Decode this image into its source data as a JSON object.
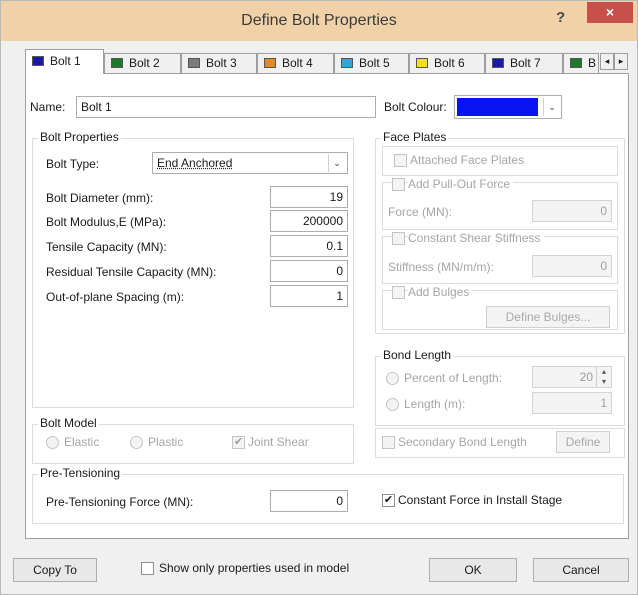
{
  "window": {
    "title": "Define Bolt Properties",
    "help": "?",
    "close": "×"
  },
  "tabs": [
    {
      "label": "Bolt 1",
      "color": "#1a1aa8"
    },
    {
      "label": "Bolt 2",
      "color": "#1e7a2a"
    },
    {
      "label": "Bolt 3",
      "color": "#7a7a7a"
    },
    {
      "label": "Bolt 4",
      "color": "#e08a2a"
    },
    {
      "label": "Bolt 5",
      "color": "#2aa8d8"
    },
    {
      "label": "Bolt 6",
      "color": "#f0e020"
    },
    {
      "label": "Bolt 7",
      "color": "#1a1aa8"
    },
    {
      "label": "B",
      "color": "#1e7a2a"
    }
  ],
  "tab_scroll": {
    "left": "◂",
    "right": "▸"
  },
  "name": {
    "label": "Name:",
    "value": "Bolt 1"
  },
  "bolt_colour": {
    "label": "Bolt Colour:",
    "value": "#0a14f0",
    "arrow": "⌄"
  },
  "bolt_properties": {
    "title": "Bolt Properties",
    "type_label": "Bolt Type:",
    "type_value": "End Anchored",
    "type_arrow": "⌄",
    "diameter_label": "Bolt Diameter (mm):",
    "diameter_value": "19",
    "modulus_label": "Bolt Modulus,E (MPa):",
    "modulus_value": "200000",
    "tensile_label": "Tensile Capacity (MN):",
    "tensile_value": "0.1",
    "residual_label": "Residual Tensile Capacity (MN):",
    "residual_value": "0",
    "spacing_label": "Out-of-plane Spacing (m):",
    "spacing_value": "1"
  },
  "face_plates": {
    "title": "Face Plates",
    "attached_label": "Attached Face Plates",
    "pullout_label": "Add Pull-Out Force",
    "force_label": "Force (MN):",
    "force_value": "0",
    "shear_label": "Constant Shear Stiffness",
    "stiffness_label": "Stiffness (MN/m/m):",
    "stiffness_value": "0",
    "bulges_label": "Add Bulges",
    "define_bulges": "Define Bulges..."
  },
  "bond_length": {
    "title": "Bond Length",
    "percent_label": "Percent of Length:",
    "percent_value": "20",
    "length_label": "Length (m):",
    "length_value": "1",
    "secondary_label": "Secondary Bond Length",
    "define": "Define"
  },
  "bolt_model": {
    "title": "Bolt Model",
    "elastic": "Elastic",
    "plastic": "Plastic",
    "joint_shear": "Joint Shear",
    "joint_shear_checked": true
  },
  "pretensioning": {
    "title": "Pre-Tensioning",
    "force_label": "Pre-Tensioning Force (MN):",
    "force_value": "0",
    "constant_label": "Constant Force in Install Stage",
    "constant_checked": true
  },
  "footer": {
    "copy_to": "Copy To",
    "show_only": "Show only properties used in model",
    "ok": "OK",
    "cancel": "Cancel"
  }
}
